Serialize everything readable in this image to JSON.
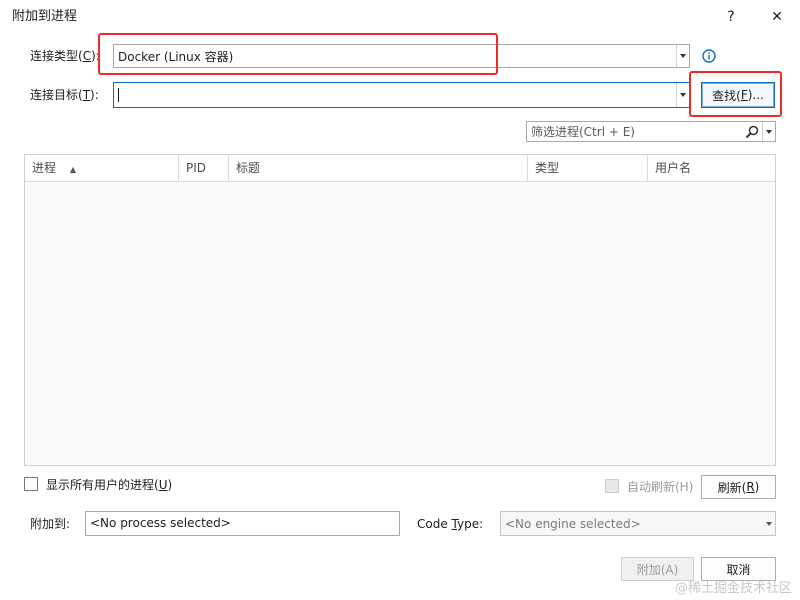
{
  "dialog": {
    "title": "附加到进程",
    "help_label": "?",
    "close_label": "✕"
  },
  "connection": {
    "type_label": "连接类型(",
    "type_key": "C",
    "type_label_end": "):",
    "type_value": "Docker (Linux 容器)",
    "target_label": "连接目标(",
    "target_key": "T",
    "target_label_end": "):",
    "target_value": "",
    "find_button": "查找(",
    "find_key": "F",
    "find_button_end": ")..."
  },
  "filter": {
    "placeholder": "筛选进程(Ctrl + E)"
  },
  "table": {
    "columns": [
      "进程",
      "PID",
      "标题",
      "类型",
      "用户名"
    ],
    "sort_indicator": "▲",
    "rows": []
  },
  "options": {
    "show_all_label": "显示所有用户的进程(",
    "show_all_key": "U",
    "show_all_end": ")",
    "show_all_checked": false,
    "auto_refresh_label": "自动刷新(H)",
    "refresh_button": "刷新(",
    "refresh_key": "R",
    "refresh_end": ")"
  },
  "attach": {
    "attach_to_label": "附加到:",
    "attach_to_value": "<No process selected>",
    "code_type_label_pre": "Code ",
    "code_type_key": "T",
    "code_type_label_post": "ype:",
    "code_type_value": "<No engine selected>"
  },
  "footer": {
    "attach_button": "附加(A)",
    "cancel_button": "取消"
  },
  "watermark": "@稀土掘金技术社区",
  "colors": {
    "highlight_box": "#f12a2a",
    "info_icon": "#0f6cbd",
    "primary_border": "#0f6cbd"
  }
}
